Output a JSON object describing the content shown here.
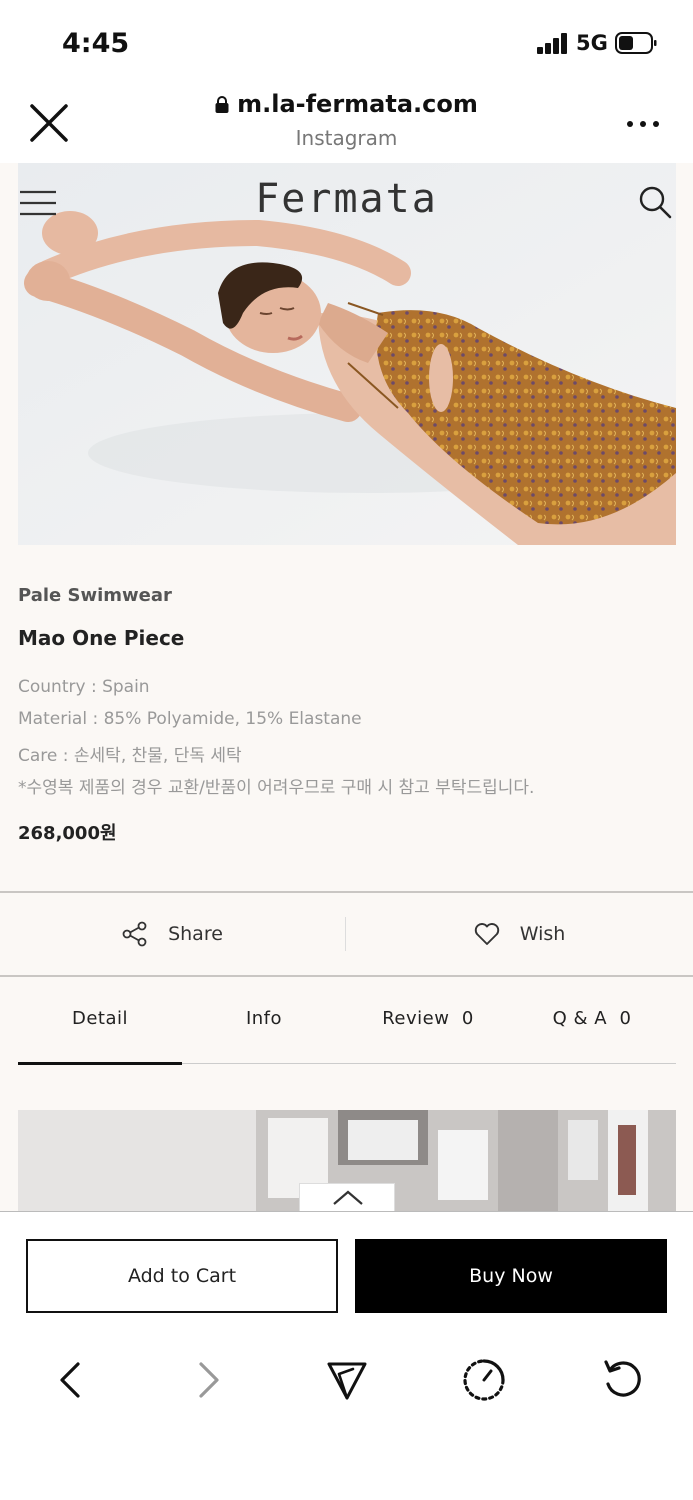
{
  "status_bar": {
    "time": "4:45",
    "network": "5G"
  },
  "browser": {
    "url": "m.la-fermata.com",
    "source": "Instagram"
  },
  "site": {
    "logo": "Fermata"
  },
  "product": {
    "brand": "Pale Swimwear",
    "name": "Mao One Piece",
    "country": "Country : Spain",
    "material": "Material : 85% Polyamide, 15% Elastane",
    "care": "Care : 손세탁, 찬물, 단독 세탁",
    "notice": "*수영복 제품의 경우 교환/반품이 어려우므로 구매 시 참고 부탁드립니다.",
    "price": "268,000원"
  },
  "actions": {
    "share": "Share",
    "wish": "Wish"
  },
  "tabs": [
    {
      "label": "Detail"
    },
    {
      "label": "Info"
    },
    {
      "label": "Review  0"
    },
    {
      "label": "Q & A  0"
    }
  ],
  "active_tab": "Detail",
  "buttons": {
    "add_to_cart": "Add to Cart",
    "buy_now": "Buy Now"
  },
  "colors": {
    "page_bg": "#fbf8f5",
    "buy_button": "#000000",
    "swimsuit": "#b0722e"
  }
}
